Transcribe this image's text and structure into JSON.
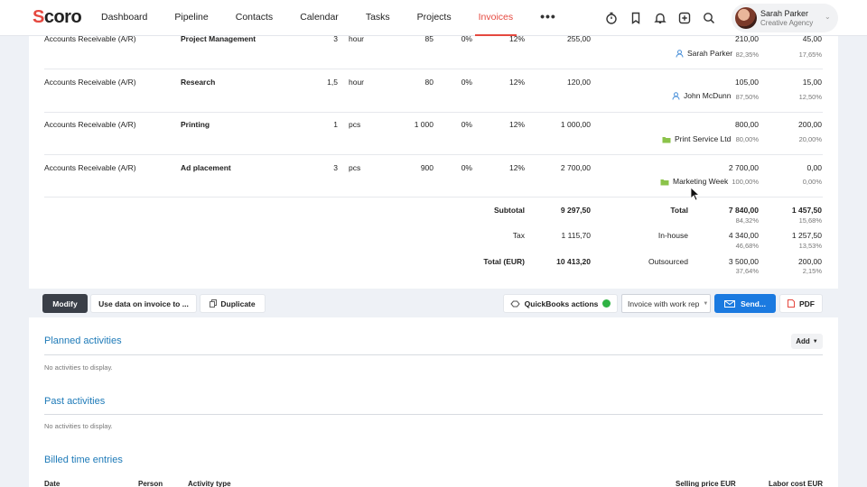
{
  "nav": {
    "logo": "Scoro",
    "items": [
      "Dashboard",
      "Pipeline",
      "Contacts",
      "Calendar",
      "Tasks",
      "Projects",
      "Invoices"
    ],
    "more": "•••",
    "active_index": 6
  },
  "user": {
    "name": "Sarah Parker",
    "org": "Creative Agency"
  },
  "lines": [
    {
      "account": "Accounts Receivable (A/R)",
      "product": "Project Management",
      "qty": "3",
      "unit": "hour",
      "price": "85",
      "discount": "0%",
      "vat": "12%",
      "sum": "255,00",
      "cost": "210,00",
      "margin": "45,00",
      "person": "Sarah Parker",
      "person_icon": "user-icon",
      "cost_pct": "82,35%",
      "margin_pct": "17,65%"
    },
    {
      "account": "Accounts Receivable (A/R)",
      "product": "Research",
      "qty": "1,5",
      "unit": "hour",
      "price": "80",
      "discount": "0%",
      "vat": "12%",
      "sum": "120,00",
      "cost": "105,00",
      "margin": "15,00",
      "person": "John McDunn",
      "person_icon": "user-icon",
      "cost_pct": "87,50%",
      "margin_pct": "12,50%"
    },
    {
      "account": "Accounts Receivable (A/R)",
      "product": "Printing",
      "qty": "1",
      "unit": "pcs",
      "price": "1 000",
      "discount": "0%",
      "vat": "12%",
      "sum": "1 000,00",
      "cost": "800,00",
      "margin": "200,00",
      "person": "Print Service Ltd",
      "person_icon": "company-icon",
      "cost_pct": "80,00%",
      "margin_pct": "20,00%"
    },
    {
      "account": "Accounts Receivable (A/R)",
      "product": "Ad placement",
      "qty": "3",
      "unit": "pcs",
      "price": "900",
      "discount": "0%",
      "vat": "12%",
      "sum": "2 700,00",
      "cost": "2 700,00",
      "margin": "0,00",
      "person": "Marketing Week",
      "person_icon": "company-icon",
      "cost_pct": "100,00%",
      "margin_pct": "0,00%"
    }
  ],
  "totals": {
    "subtotal_label": "Subtotal",
    "subtotal": "9 297,50",
    "tax_label": "Tax",
    "tax": "1 115,70",
    "total_label": "Total (EUR)",
    "total": "10 413,20",
    "total_cost_label": "Total",
    "total_cost": "7 840,00",
    "total_cost_pct": "84,32%",
    "total_margin": "1 457,50",
    "total_margin_pct": "15,68%",
    "inhouse_label": "In-house",
    "inhouse_cost": "4 340,00",
    "inhouse_cost_pct": "46,68%",
    "inhouse_margin": "1 257,50",
    "inhouse_margin_pct": "13,53%",
    "outsourced_label": "Outsourced",
    "outsourced_cost": "3 500,00",
    "outsourced_cost_pct": "37,64%",
    "outsourced_margin": "200,00",
    "outsourced_margin_pct": "2,15%"
  },
  "actions": {
    "modify": "Modify",
    "use_data": "Use data on invoice to ...",
    "duplicate": "Duplicate",
    "quickbooks": "QuickBooks actions",
    "template_select": "Invoice with work rep",
    "send": "Send...",
    "pdf": "PDF"
  },
  "sections": {
    "planned_title": "Planned activities",
    "planned_empty": "No activities to display.",
    "add_label": "Add",
    "past_title": "Past activities",
    "past_empty": "No activities to display.",
    "billed_title": "Billed time entries",
    "billed_headers": [
      "Date",
      "Person",
      "Activity type",
      "Selling price EUR",
      "Labor cost EUR"
    ]
  },
  "colors": {
    "brand": "#e5483f",
    "link": "#1d7ab8",
    "primary_button": "#1b7ae0",
    "status_ok": "#2fb344"
  }
}
